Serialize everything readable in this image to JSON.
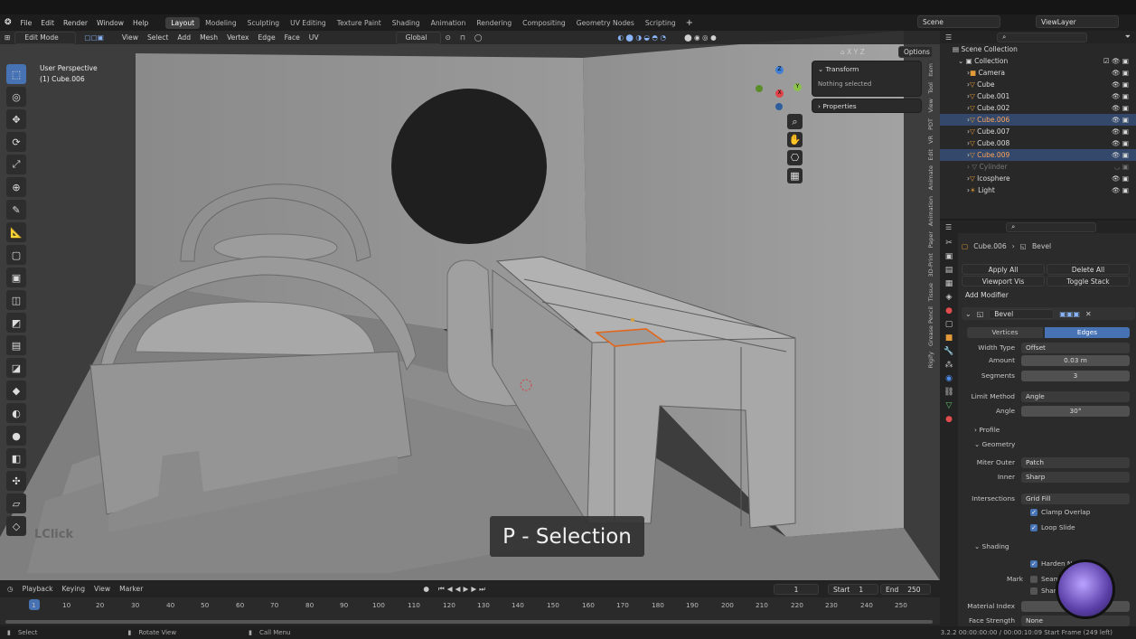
{
  "menu": [
    "File",
    "Edit",
    "Render",
    "Window",
    "Help"
  ],
  "workspaces": [
    "Layout",
    "Modeling",
    "Sculpting",
    "UV Editing",
    "Texture Paint",
    "Shading",
    "Animation",
    "Rendering",
    "Compositing",
    "Geometry Nodes",
    "Scripting"
  ],
  "scene": "Scene",
  "view_layer": "ViewLayer",
  "header": {
    "mode": "Edit Mode",
    "menus": [
      "View",
      "Select",
      "Add",
      "Mesh",
      "Vertex",
      "Edge",
      "Face",
      "UV"
    ],
    "orientation": "Global",
    "options": "Options"
  },
  "overlay": {
    "perspective": "User Perspective",
    "object": "(1) Cube.006",
    "click_hint": "LClick"
  },
  "npanel": {
    "transform": "Transform",
    "nothing": "Nothing selected",
    "properties": "Properties"
  },
  "side_tabs": [
    "Item",
    "Tool",
    "View",
    "PDT",
    "VR",
    "Edit",
    "Animate",
    "Animation",
    "Paper",
    "3D-Print",
    "Tissue",
    "Grease Pencil",
    "Rigify"
  ],
  "gizmo": {
    "x": "X",
    "y": "Y",
    "z": "Z"
  },
  "caption": "P - Selection",
  "outliner": {
    "root": "Scene Collection",
    "collection": "Collection",
    "items": [
      "Camera",
      "Cube",
      "Cube.001",
      "Cube.002",
      "Cube.006",
      "Cube.007",
      "Cube.008",
      "Cube.009",
      "Cylinder",
      "Icosphere",
      "Light"
    ]
  },
  "props": {
    "object": "Cube.006",
    "modifier_name": "Bevel",
    "apply_all": "Apply All",
    "delete_all": "Delete All",
    "viewport_vis": "Viewport Vis",
    "toggle_stack": "Toggle Stack",
    "add_modifier": "Add Modifier",
    "vertices": "Vertices",
    "edges": "Edges",
    "width_type_l": "Width Type",
    "width_type": "Offset",
    "amount_l": "Amount",
    "amount": "0.03 m",
    "segments_l": "Segments",
    "segments": "3",
    "limit_l": "Limit Method",
    "limit": "Angle",
    "angle_l": "Angle",
    "angle": "30°",
    "profile": "Profile",
    "geometry": "Geometry",
    "miter_l": "Miter Outer",
    "miter": "Patch",
    "inner_l": "Inner",
    "inner": "Sharp",
    "inter_l": "Intersections",
    "inter": "Grid Fill",
    "clamp": "Clamp Overlap",
    "loop": "Loop Slide",
    "shading": "Shading",
    "harden": "Harden Norm",
    "mark_l": "Mark",
    "seam": "Seam",
    "sharp": "Sharp",
    "matidx_l": "Material Index",
    "face_l": "Face Strength",
    "face": "None"
  },
  "timeline": {
    "menus": [
      "Playback",
      "Keying",
      "View",
      "Marker"
    ],
    "current": "1",
    "start_l": "Start",
    "start": "1",
    "end_l": "End",
    "end": "250",
    "ticks": [
      "1",
      "10",
      "20",
      "30",
      "40",
      "50",
      "60",
      "70",
      "80",
      "90",
      "100",
      "110",
      "120",
      "130",
      "140",
      "150",
      "160",
      "170",
      "180",
      "190",
      "200",
      "210",
      "220",
      "230",
      "240",
      "250"
    ]
  },
  "status": {
    "select": "Select",
    "rotate": "Rotate View",
    "menu": "Call Menu",
    "version": "3.2.2  00:00:00:00 / 00:00:10:09  Start Frame (249 left)"
  },
  "colors": {
    "accent": "#4772b3",
    "selected_text": "#ffa65c",
    "viewport": "#3b3b3b"
  }
}
